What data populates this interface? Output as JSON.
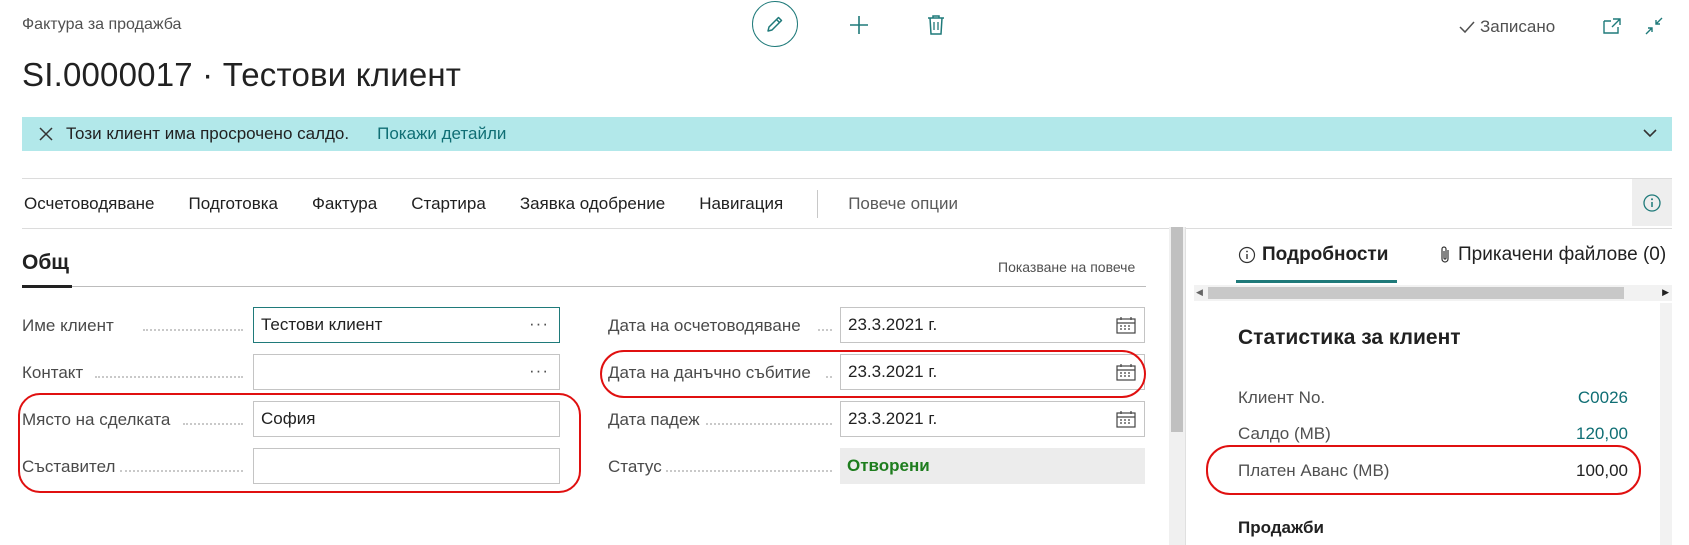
{
  "header": {
    "page_type": "Фактура за продажба",
    "title": "SI.0000017 · Тестови клиент",
    "saved_label": "Записано"
  },
  "banner": {
    "message": "Този клиент има просрочено салдо.",
    "link": "Покажи детайли"
  },
  "actions": {
    "items": [
      "Осчетоводяване",
      "Подготовка",
      "Фактура",
      "Стартира",
      "Заявка одобрение",
      "Навигация"
    ],
    "more": "Повече опции"
  },
  "general": {
    "title": "Общ",
    "show_more": "Показване на повече",
    "left_fields": [
      {
        "label": "Име клиент",
        "value": "Тестови клиент"
      },
      {
        "label": "Контакт",
        "value": ""
      },
      {
        "label": "Място на сделката",
        "value": "София"
      },
      {
        "label": "Съставител",
        "value": ""
      }
    ],
    "right_fields": [
      {
        "label": "Дата на осчетоводяване",
        "value": "23.3.2021 г."
      },
      {
        "label": "Дата на данъчно събитие",
        "value": "23.3.2021 г."
      },
      {
        "label": "Дата падеж",
        "value": "23.3.2021 г."
      },
      {
        "label": "Статус",
        "value": "Отворени"
      }
    ],
    "status_color": "#1e7d1e"
  },
  "factbox": {
    "tabs": [
      "Подробности",
      "Прикачени файлове (0)"
    ],
    "card_title": "Статистика за клиент",
    "rows": [
      {
        "label": "Клиент No.",
        "value": "C0026"
      },
      {
        "label": "Салдо (МВ)",
        "value": "120,00"
      },
      {
        "label": "Платен Аванс (МВ)",
        "value": "100,00"
      }
    ],
    "subheading": "Продажби"
  },
  "colors": {
    "accent": "#1f7a7a",
    "banner_bg": "#b2e8ea",
    "highlight": "#e01010"
  },
  "icons": [
    "edit-icon",
    "plus-icon",
    "delete-icon",
    "check-icon",
    "open-new-window-icon",
    "collapse-icon",
    "close-icon",
    "chevron-down-icon",
    "info-icon",
    "lookup-ellipsis-icon",
    "calendar-icon",
    "paperclip-icon"
  ]
}
